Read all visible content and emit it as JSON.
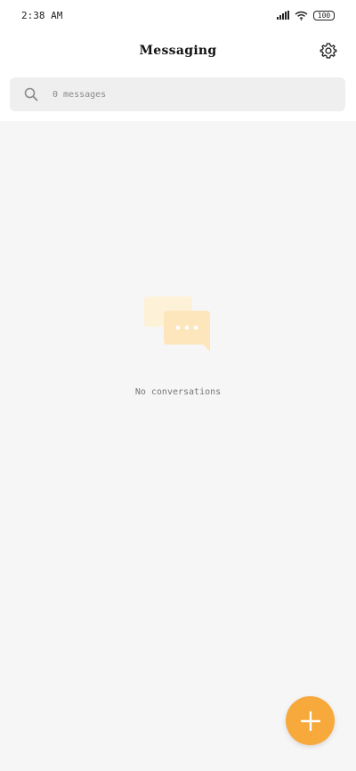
{
  "status_bar": {
    "time": "2:38 AM",
    "battery": "100",
    "icons": [
      "signal-icon",
      "wifi-icon",
      "battery-icon"
    ]
  },
  "header": {
    "title": "Messaging",
    "settings_icon": "gear-icon"
  },
  "search": {
    "placeholder": "0 messages",
    "icon": "search-icon"
  },
  "empty_state": {
    "illustration": "chat-bubbles-icon",
    "text": "No conversations"
  },
  "fab": {
    "icon": "plus-icon"
  },
  "colors": {
    "accent": "#f7a93b",
    "content_bg": "#f6f6f6",
    "search_bg": "#efefef"
  }
}
